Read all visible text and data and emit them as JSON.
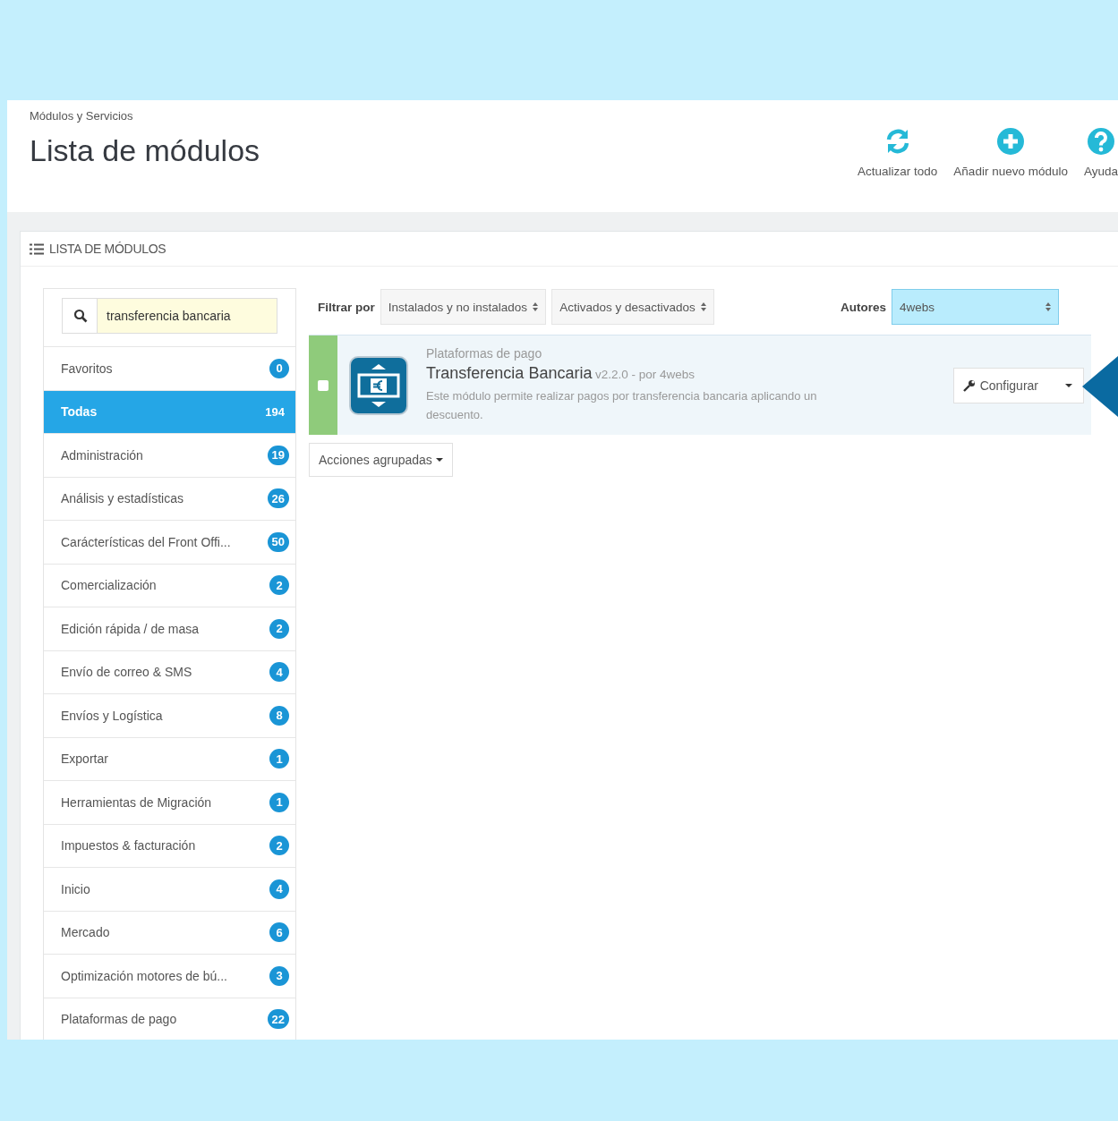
{
  "breadcrumb": "Módulos y Servicios",
  "title": "Lista de módulos",
  "toolbar": [
    {
      "kind": "refresh",
      "label": "Actualizar todo"
    },
    {
      "kind": "add",
      "label": "Añadir nuevo módulo"
    },
    {
      "kind": "help",
      "label": "Ayuda"
    }
  ],
  "panel": {
    "heading": "LISTA DE MÓDULOS"
  },
  "search": {
    "value": "transferencia bancaria"
  },
  "categories": [
    {
      "label": "Favoritos",
      "count": "0",
      "selected": false
    },
    {
      "label": "Todas",
      "count": "194",
      "selected": true
    },
    {
      "label": "Administración",
      "count": "19",
      "selected": false
    },
    {
      "label": "Análisis y estadísticas",
      "count": "26",
      "selected": false
    },
    {
      "label": "Carácterísticas del Front Offi...",
      "count": "50",
      "selected": false
    },
    {
      "label": "Comercialización",
      "count": "2",
      "selected": false
    },
    {
      "label": "Edición rápida / de masa",
      "count": "2",
      "selected": false
    },
    {
      "label": "Envío de correo & SMS",
      "count": "4",
      "selected": false
    },
    {
      "label": "Envíos y Logística",
      "count": "8",
      "selected": false
    },
    {
      "label": "Exportar",
      "count": "1",
      "selected": false
    },
    {
      "label": "Herramientas de Migración",
      "count": "1",
      "selected": false
    },
    {
      "label": "Impuestos & facturación",
      "count": "2",
      "selected": false
    },
    {
      "label": "Inicio",
      "count": "4",
      "selected": false
    },
    {
      "label": "Mercado",
      "count": "6",
      "selected": false
    },
    {
      "label": "Optimización motores de bú...",
      "count": "3",
      "selected": false
    },
    {
      "label": "Plataformas de pago",
      "count": "22",
      "selected": false
    }
  ],
  "filters": {
    "label": "Filtrar por",
    "selects": [
      "Instalados y no instalados",
      "Activados y desactivados"
    ],
    "authors_label": "Autores",
    "authors_value": "4webs"
  },
  "modules": [
    {
      "category": "Plataformas de pago",
      "name": "Transferencia Bancaria",
      "meta": "v2.2.0 - por 4webs",
      "description": "Este módulo permite realizar pagos por transferencia bancaria aplicando un descuento.",
      "installed": true,
      "checked": false,
      "action": "Configurar"
    }
  ],
  "bulk_actions": "Acciones agrupadas"
}
